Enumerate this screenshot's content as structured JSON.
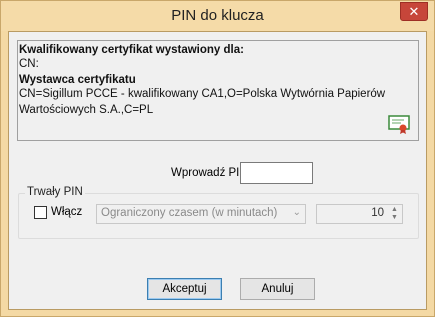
{
  "window": {
    "title": "PIN do klucza",
    "close_label": "✕"
  },
  "certificate": {
    "heading": "Kwalifikowany certyfikat wystawiony dla:",
    "cn_line": "CN:",
    "issuer_heading": "Wystawca certyfikatu",
    "issuer_line1": "CN=Sigillum PCCE - kwalifikowany CA1,O=Polska Wytwórnia Papierów",
    "issuer_line2": "Wartościowych S.A.,C=PL",
    "icon": "certificate-icon"
  },
  "pin": {
    "label": "Wprowadź PIN do klucza",
    "value": ""
  },
  "persistent_pin": {
    "group_title": "Trwały PIN",
    "enable_label": "Włącz",
    "enabled": false,
    "mode_selected": "Ograniczony czasem (w minutach)",
    "minutes": "10"
  },
  "buttons": {
    "ok": "Akceptuj",
    "cancel": "Anuluj"
  }
}
